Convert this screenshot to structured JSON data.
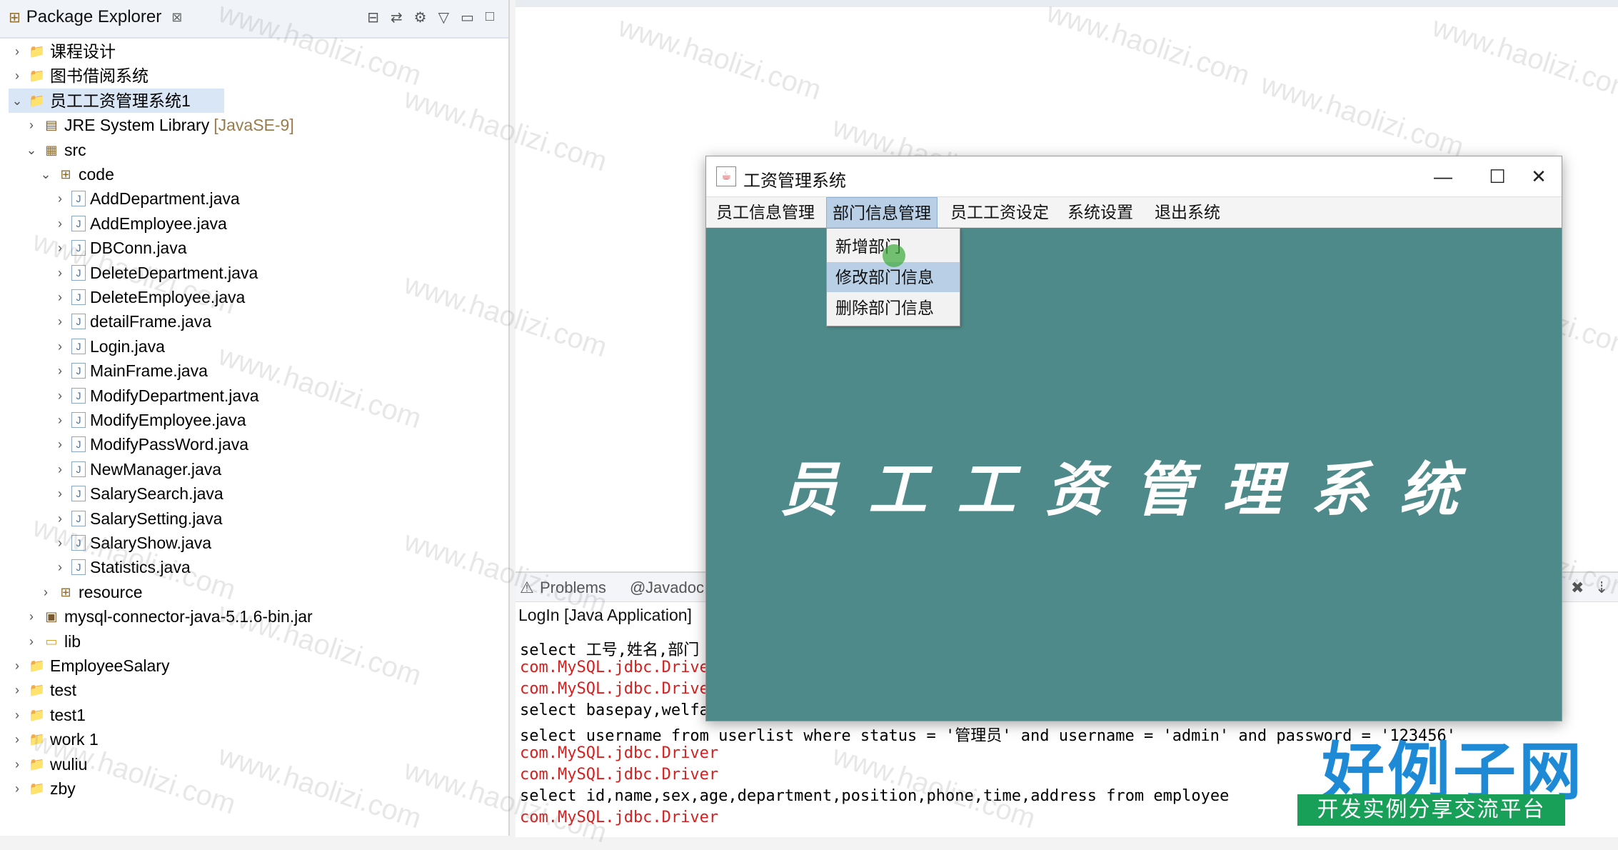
{
  "explorer": {
    "title": "Package Explorer",
    "close_glyph": "⊠",
    "tree": [
      {
        "label": "课程设计",
        "icon": "project-icon",
        "level": 0,
        "twisty": "›"
      },
      {
        "label": "图书借阅系统",
        "icon": "project-icon",
        "level": 0,
        "twisty": "›"
      },
      {
        "label": "员工工资管理系统1",
        "icon": "project-icon",
        "level": 0,
        "twisty": "⌄",
        "selected": true
      },
      {
        "label": "JRE System Library",
        "suffix": "[JavaSE-9]",
        "icon": "library-icon",
        "level": 1,
        "twisty": "›"
      },
      {
        "label": "src",
        "icon": "source-folder-icon",
        "level": 1,
        "twisty": "⌄"
      },
      {
        "label": "code",
        "icon": "package-icon",
        "level": 2,
        "twisty": "⌄"
      },
      {
        "label": "AddDepartment.java",
        "icon": "java-file-icon",
        "level": 3,
        "twisty": "›"
      },
      {
        "label": "AddEmployee.java",
        "icon": "java-file-icon",
        "level": 3,
        "twisty": "›"
      },
      {
        "label": "DBConn.java",
        "icon": "java-file-icon",
        "level": 3,
        "twisty": "›"
      },
      {
        "label": "DeleteDepartment.java",
        "icon": "java-file-icon",
        "level": 3,
        "twisty": "›"
      },
      {
        "label": "DeleteEmployee.java",
        "icon": "java-file-icon",
        "level": 3,
        "twisty": "›"
      },
      {
        "label": "detailFrame.java",
        "icon": "java-file-icon",
        "level": 3,
        "twisty": "›"
      },
      {
        "label": "Login.java",
        "icon": "java-file-icon",
        "level": 3,
        "twisty": "›"
      },
      {
        "label": "MainFrame.java",
        "icon": "java-file-icon",
        "level": 3,
        "twisty": "›"
      },
      {
        "label": "ModifyDepartment.java",
        "icon": "java-file-icon",
        "level": 3,
        "twisty": "›"
      },
      {
        "label": "ModifyEmployee.java",
        "icon": "java-file-icon",
        "level": 3,
        "twisty": "›"
      },
      {
        "label": "ModifyPassWord.java",
        "icon": "java-file-icon",
        "level": 3,
        "twisty": "›"
      },
      {
        "label": "NewManager.java",
        "icon": "java-file-icon",
        "level": 3,
        "twisty": "›"
      },
      {
        "label": "SalarySearch.java",
        "icon": "java-file-icon",
        "level": 3,
        "twisty": "›"
      },
      {
        "label": "SalarySetting.java",
        "icon": "java-file-icon",
        "level": 3,
        "twisty": "›"
      },
      {
        "label": "SalaryShow.java",
        "icon": "java-file-icon",
        "level": 3,
        "twisty": "›"
      },
      {
        "label": "Statistics.java",
        "icon": "java-file-icon",
        "level": 3,
        "twisty": "›"
      },
      {
        "label": "resource",
        "icon": "package-icon",
        "level": 2,
        "twisty": "›"
      },
      {
        "label": "mysql-connector-java-5.1.6-bin.jar",
        "icon": "jar-icon",
        "level": 1,
        "twisty": "›"
      },
      {
        "label": "lib",
        "icon": "folder-icon",
        "level": 1,
        "twisty": "›"
      },
      {
        "label": "EmployeeSalary",
        "icon": "project-icon",
        "level": 0,
        "twisty": "›"
      },
      {
        "label": "test",
        "icon": "project-icon",
        "level": 0,
        "twisty": "›"
      },
      {
        "label": "test1",
        "icon": "project-icon",
        "level": 0,
        "twisty": "›"
      },
      {
        "label": "work 1",
        "icon": "project-icon",
        "level": 0,
        "twisty": "›"
      },
      {
        "label": "wuliu",
        "icon": "project-icon",
        "level": 0,
        "twisty": "›"
      },
      {
        "label": "zby",
        "icon": "project-icon",
        "level": 0,
        "twisty": "›"
      }
    ]
  },
  "console": {
    "tabs": {
      "problems": "Problems",
      "javadoc": "Javadoc"
    },
    "title": "LogIn [Java Application]",
    "lines": [
      {
        "text": "select 工号,姓名,部门",
        "error": false
      },
      {
        "text": "com.MySQL.jdbc.Drive",
        "error": true
      },
      {
        "text": "com.MySQL.jdbc.Drive",
        "error": true
      },
      {
        "text": "select basepay,welfa",
        "error": false
      },
      {
        "text": "select username from userlist where status = '管理员' and username = 'admin' and password = '123456'",
        "error": false
      },
      {
        "text": "com.MySQL.jdbc.Driver",
        "error": true
      },
      {
        "text": "com.MySQL.jdbc.Driver",
        "error": true
      },
      {
        "text": "select id,name,sex,age,department,position,phone,time,address from employee",
        "error": false
      },
      {
        "text": "com.MySQL.jdbc.Driver",
        "error": true
      }
    ]
  },
  "app": {
    "title": "工资管理系统",
    "window_controls": {
      "minimize": "—",
      "maximize": "☐",
      "close": "✕"
    },
    "menus": [
      "员工信息管理",
      "部门信息管理",
      "员工工资设定",
      "系统设置",
      "退出系统"
    ],
    "active_menu_index": 1,
    "dropdown": [
      "新增部门",
      "修改部门信息",
      "删除部门信息"
    ],
    "hover_index": 1,
    "banner_text": "员工工资管理系统",
    "banner_color": "#4f8a8a"
  },
  "watermark": "www.haolizi.com",
  "logo": {
    "main": "好例子网",
    "sub": "开发实例分享交流平台"
  }
}
